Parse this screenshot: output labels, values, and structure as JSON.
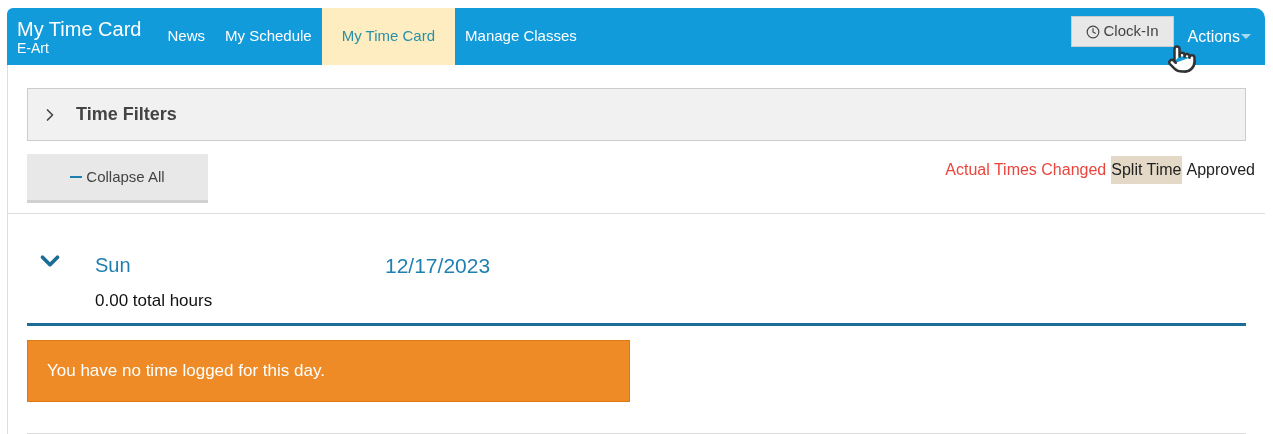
{
  "header": {
    "title": "My Time Card",
    "subtitle": "E-Art"
  },
  "tabs": [
    {
      "label": "News",
      "selected": false
    },
    {
      "label": "My Schedule",
      "selected": false
    },
    {
      "label": "My Time Card",
      "selected": true
    },
    {
      "label": "Manage Classes",
      "selected": false
    }
  ],
  "clock_in_button": "Clock-In",
  "actions_menu": "Actions",
  "filters": {
    "label": "Time Filters",
    "expanded": false
  },
  "collapse_button": "Collapse All",
  "legend": [
    {
      "label": "Actual Times Changed",
      "kind": "changed"
    },
    {
      "label": "Split Time",
      "kind": "split"
    },
    {
      "label": "Approved",
      "kind": "approved"
    }
  ],
  "days": [
    {
      "day": "Sun",
      "date": "12/17/2023",
      "total": "0.00 total hours",
      "expanded": true,
      "message": "You have no time logged for this day."
    }
  ]
}
